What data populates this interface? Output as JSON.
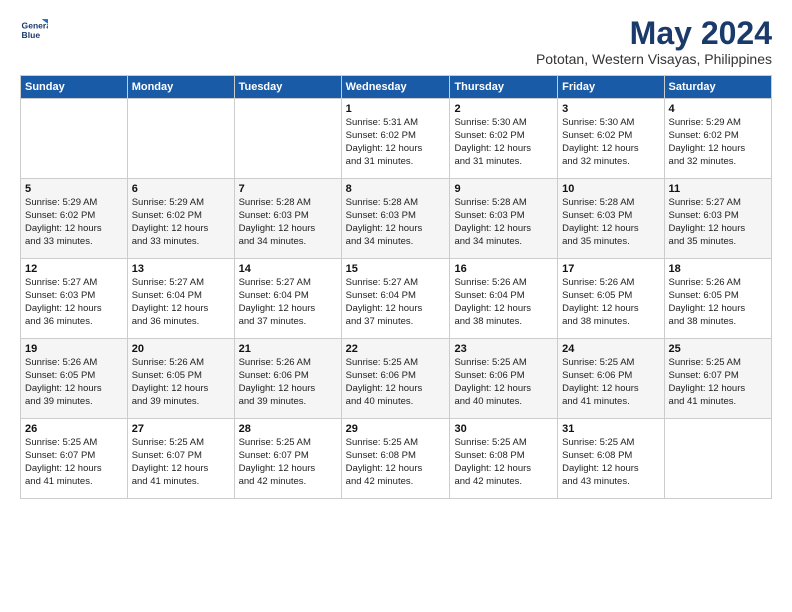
{
  "logo": {
    "line1": "General",
    "line2": "Blue"
  },
  "title": "May 2024",
  "subtitle": "Pototan, Western Visayas, Philippines",
  "days_of_week": [
    "Sunday",
    "Monday",
    "Tuesday",
    "Wednesday",
    "Thursday",
    "Friday",
    "Saturday"
  ],
  "weeks": [
    [
      {
        "day": "",
        "info": ""
      },
      {
        "day": "",
        "info": ""
      },
      {
        "day": "",
        "info": ""
      },
      {
        "day": "1",
        "info": "Sunrise: 5:31 AM\nSunset: 6:02 PM\nDaylight: 12 hours\nand 31 minutes."
      },
      {
        "day": "2",
        "info": "Sunrise: 5:30 AM\nSunset: 6:02 PM\nDaylight: 12 hours\nand 31 minutes."
      },
      {
        "day": "3",
        "info": "Sunrise: 5:30 AM\nSunset: 6:02 PM\nDaylight: 12 hours\nand 32 minutes."
      },
      {
        "day": "4",
        "info": "Sunrise: 5:29 AM\nSunset: 6:02 PM\nDaylight: 12 hours\nand 32 minutes."
      }
    ],
    [
      {
        "day": "5",
        "info": "Sunrise: 5:29 AM\nSunset: 6:02 PM\nDaylight: 12 hours\nand 33 minutes."
      },
      {
        "day": "6",
        "info": "Sunrise: 5:29 AM\nSunset: 6:02 PM\nDaylight: 12 hours\nand 33 minutes."
      },
      {
        "day": "7",
        "info": "Sunrise: 5:28 AM\nSunset: 6:03 PM\nDaylight: 12 hours\nand 34 minutes."
      },
      {
        "day": "8",
        "info": "Sunrise: 5:28 AM\nSunset: 6:03 PM\nDaylight: 12 hours\nand 34 minutes."
      },
      {
        "day": "9",
        "info": "Sunrise: 5:28 AM\nSunset: 6:03 PM\nDaylight: 12 hours\nand 34 minutes."
      },
      {
        "day": "10",
        "info": "Sunrise: 5:28 AM\nSunset: 6:03 PM\nDaylight: 12 hours\nand 35 minutes."
      },
      {
        "day": "11",
        "info": "Sunrise: 5:27 AM\nSunset: 6:03 PM\nDaylight: 12 hours\nand 35 minutes."
      }
    ],
    [
      {
        "day": "12",
        "info": "Sunrise: 5:27 AM\nSunset: 6:03 PM\nDaylight: 12 hours\nand 36 minutes."
      },
      {
        "day": "13",
        "info": "Sunrise: 5:27 AM\nSunset: 6:04 PM\nDaylight: 12 hours\nand 36 minutes."
      },
      {
        "day": "14",
        "info": "Sunrise: 5:27 AM\nSunset: 6:04 PM\nDaylight: 12 hours\nand 37 minutes."
      },
      {
        "day": "15",
        "info": "Sunrise: 5:27 AM\nSunset: 6:04 PM\nDaylight: 12 hours\nand 37 minutes."
      },
      {
        "day": "16",
        "info": "Sunrise: 5:26 AM\nSunset: 6:04 PM\nDaylight: 12 hours\nand 38 minutes."
      },
      {
        "day": "17",
        "info": "Sunrise: 5:26 AM\nSunset: 6:05 PM\nDaylight: 12 hours\nand 38 minutes."
      },
      {
        "day": "18",
        "info": "Sunrise: 5:26 AM\nSunset: 6:05 PM\nDaylight: 12 hours\nand 38 minutes."
      }
    ],
    [
      {
        "day": "19",
        "info": "Sunrise: 5:26 AM\nSunset: 6:05 PM\nDaylight: 12 hours\nand 39 minutes."
      },
      {
        "day": "20",
        "info": "Sunrise: 5:26 AM\nSunset: 6:05 PM\nDaylight: 12 hours\nand 39 minutes."
      },
      {
        "day": "21",
        "info": "Sunrise: 5:26 AM\nSunset: 6:06 PM\nDaylight: 12 hours\nand 39 minutes."
      },
      {
        "day": "22",
        "info": "Sunrise: 5:25 AM\nSunset: 6:06 PM\nDaylight: 12 hours\nand 40 minutes."
      },
      {
        "day": "23",
        "info": "Sunrise: 5:25 AM\nSunset: 6:06 PM\nDaylight: 12 hours\nand 40 minutes."
      },
      {
        "day": "24",
        "info": "Sunrise: 5:25 AM\nSunset: 6:06 PM\nDaylight: 12 hours\nand 41 minutes."
      },
      {
        "day": "25",
        "info": "Sunrise: 5:25 AM\nSunset: 6:07 PM\nDaylight: 12 hours\nand 41 minutes."
      }
    ],
    [
      {
        "day": "26",
        "info": "Sunrise: 5:25 AM\nSunset: 6:07 PM\nDaylight: 12 hours\nand 41 minutes."
      },
      {
        "day": "27",
        "info": "Sunrise: 5:25 AM\nSunset: 6:07 PM\nDaylight: 12 hours\nand 41 minutes."
      },
      {
        "day": "28",
        "info": "Sunrise: 5:25 AM\nSunset: 6:07 PM\nDaylight: 12 hours\nand 42 minutes."
      },
      {
        "day": "29",
        "info": "Sunrise: 5:25 AM\nSunset: 6:08 PM\nDaylight: 12 hours\nand 42 minutes."
      },
      {
        "day": "30",
        "info": "Sunrise: 5:25 AM\nSunset: 6:08 PM\nDaylight: 12 hours\nand 42 minutes."
      },
      {
        "day": "31",
        "info": "Sunrise: 5:25 AM\nSunset: 6:08 PM\nDaylight: 12 hours\nand 43 minutes."
      },
      {
        "day": "",
        "info": ""
      }
    ]
  ]
}
